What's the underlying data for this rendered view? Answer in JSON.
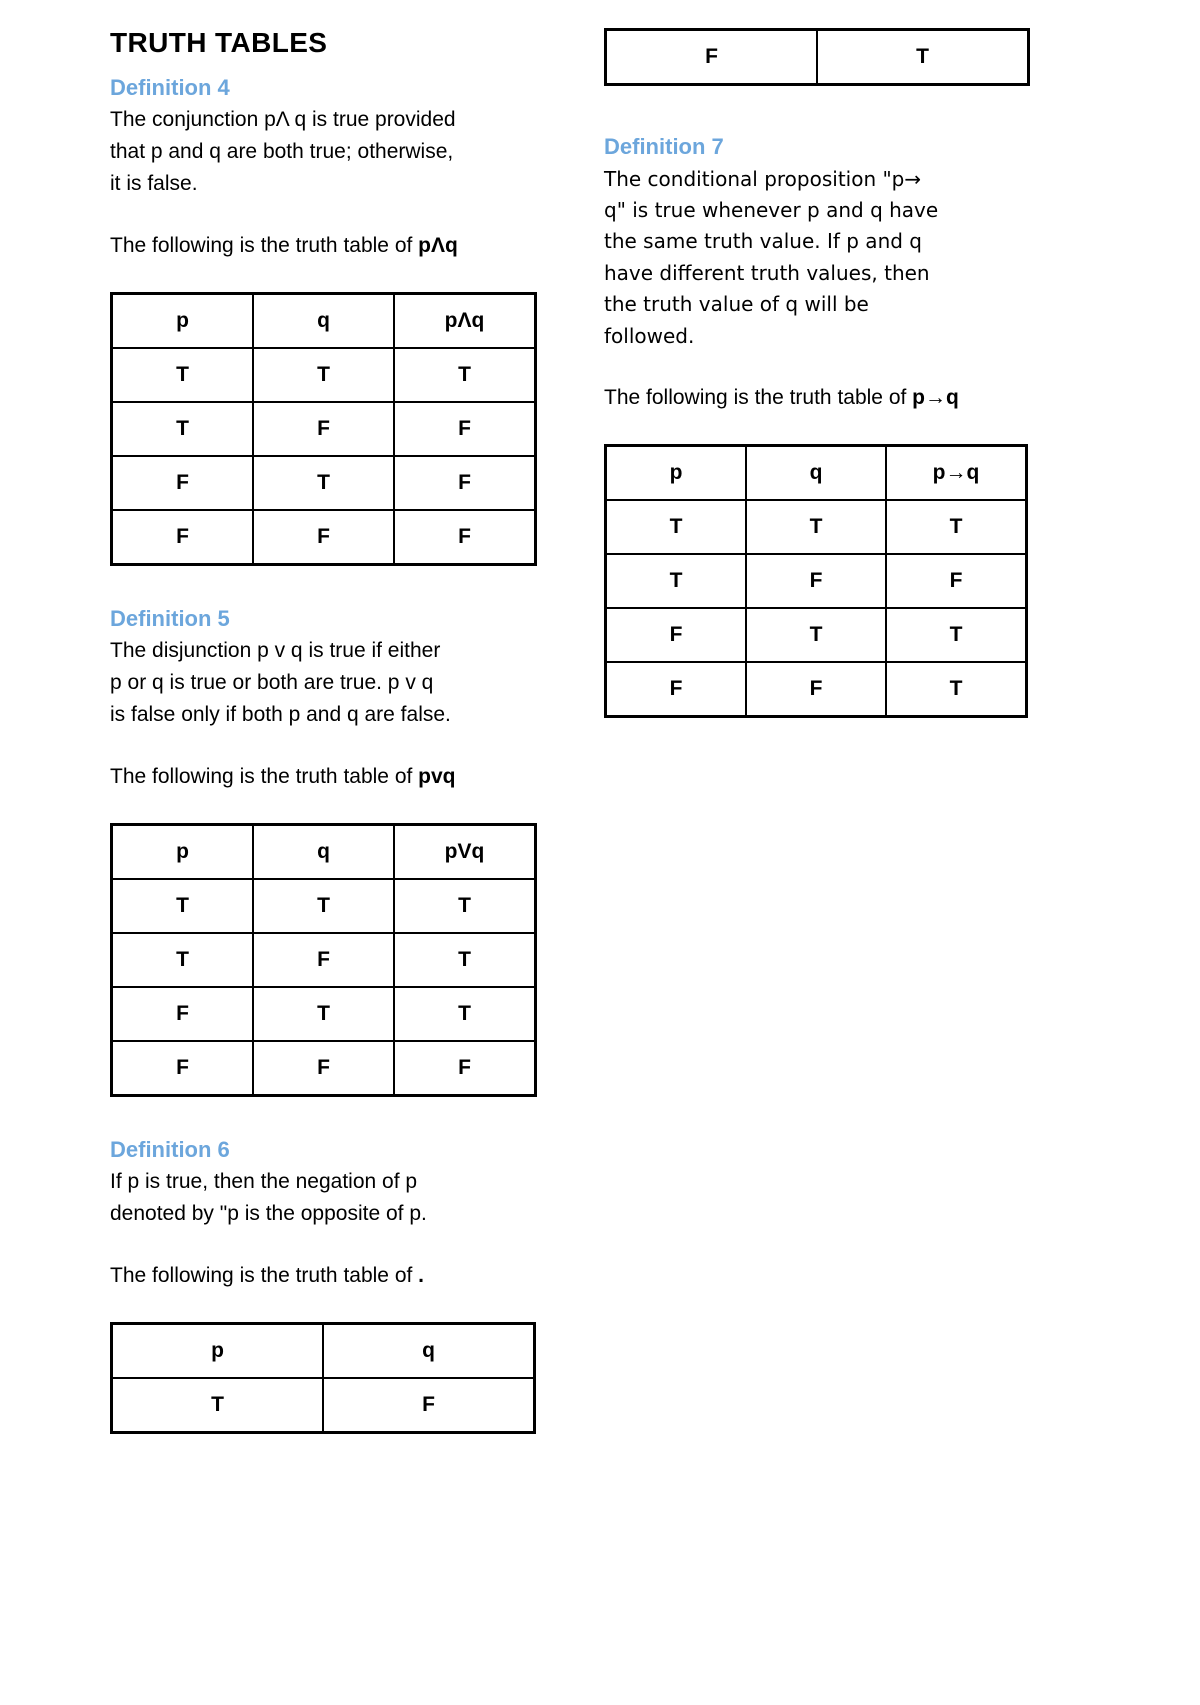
{
  "document": {
    "title": "TRUTH TABLES",
    "accent_color": "#6CA6DC",
    "text_color": "#000000",
    "background_color": "#ffffff"
  },
  "left_column": {
    "definition4": {
      "heading": "Definition 4",
      "body_line1": "The conjunction pΛ q is true provided",
      "body_line2": "that p and q are both true; otherwise,",
      "body_line3": "it is false.",
      "lead_prefix": "The following is the truth table of ",
      "lead_symbol": "pΛq"
    },
    "table_conjunction": {
      "headers": [
        "p",
        "q",
        "pΛq"
      ],
      "rows": [
        [
          "T",
          "T",
          "T"
        ],
        [
          "T",
          "F",
          "F"
        ],
        [
          "F",
          "T",
          "F"
        ],
        [
          "F",
          "F",
          "F"
        ]
      ]
    },
    "definition5": {
      "heading": "Definition 5",
      "body_line1": "The disjunction p v q is true if either",
      "body_line2": "p or q is true or both are true. p v q",
      "body_line3": "is false only if both p and q are false.",
      "lead_prefix": "The following is the truth table of ",
      "lead_symbol": "pvq"
    },
    "table_disjunction": {
      "headers": [
        "p",
        "q",
        "pVq"
      ],
      "rows": [
        [
          "T",
          "T",
          "T"
        ],
        [
          "T",
          "F",
          "T"
        ],
        [
          "F",
          "T",
          "T"
        ],
        [
          "F",
          "F",
          "F"
        ]
      ]
    },
    "definition6": {
      "heading": "Definition 6",
      "body_line1": "If p is true, then the negation of p",
      "body_line2": "denoted by \"p is the opposite of p.",
      "lead_prefix": "The following is the truth table of ",
      "lead_symbol": "."
    },
    "table_negation": {
      "headers": [
        "p",
        "q"
      ],
      "rows": [
        [
          "T",
          "F"
        ]
      ]
    }
  },
  "right_column": {
    "table_negation_continued": {
      "rows": [
        [
          "F",
          "T"
        ]
      ]
    },
    "definition7": {
      "heading": "Definition 7",
      "body_line1": "The conditional proposition \"p→",
      "body_line2": "q\" is true whenever p and q have",
      "body_line3": "the same truth value. If p and q",
      "body_line4": "have different truth values, then",
      "body_line5": "the truth value of q will be",
      "body_line6": "followed.",
      "lead_prefix": "The following is the truth table of ",
      "lead_symbol": "p→q"
    },
    "table_conditional": {
      "headers": [
        "p",
        "q",
        "p→q"
      ],
      "rows": [
        [
          "T",
          "T",
          "T"
        ],
        [
          "T",
          "F",
          "F"
        ],
        [
          "F",
          "T",
          "T"
        ],
        [
          "F",
          "F",
          "T"
        ]
      ]
    }
  }
}
